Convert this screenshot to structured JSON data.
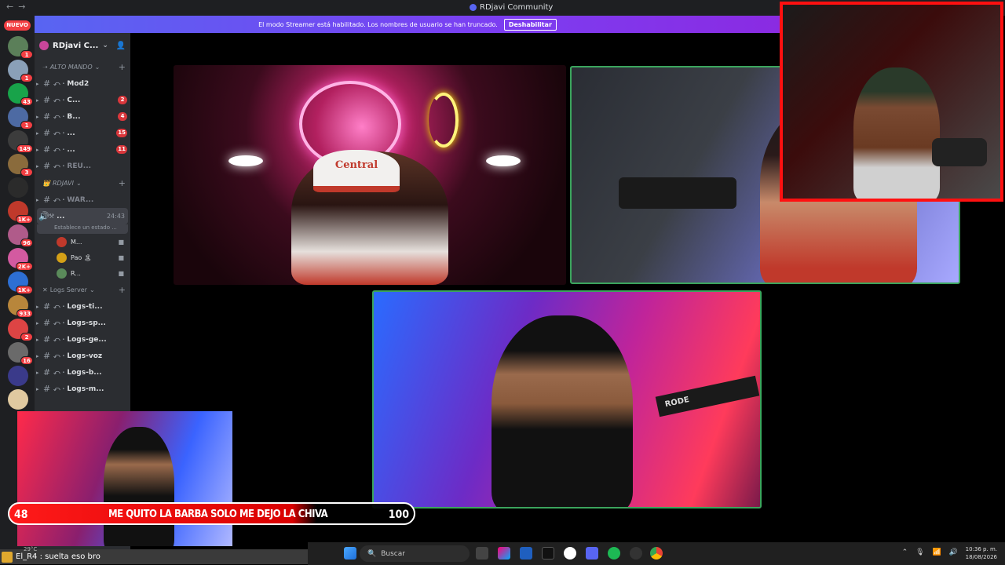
{
  "window": {
    "title": "RDjavi Community",
    "nav_back": "←",
    "nav_forward": "→"
  },
  "banner": {
    "text": "El modo Streamer está habilitado. Los nombres de usuario se han truncado.",
    "button": "Deshabilitar"
  },
  "rail": {
    "new_label": "NUEVO",
    "servers": [
      {
        "count": "1",
        "color": "#5b7f59"
      },
      {
        "count": "1",
        "color": "#8aa0b8"
      },
      {
        "count": "43",
        "color": "#18a34a"
      },
      {
        "count": "1",
        "color": "#4d6aa3"
      },
      {
        "count": "149",
        "color": "#3c3c3c"
      },
      {
        "count": "3",
        "color": "#8a6b3c"
      },
      {
        "count": "",
        "color": "#2b2b2b"
      },
      {
        "count": "1K+",
        "color": "#c0392b"
      },
      {
        "count": "96",
        "color": "#b05b8a"
      },
      {
        "count": "2K+",
        "color": "#d35aa0"
      },
      {
        "count": "1K+",
        "color": "#2d6fd3"
      },
      {
        "count": "933",
        "color": "#b8863b"
      },
      {
        "count": "2",
        "color": "#d44"
      },
      {
        "count": "16",
        "color": "#6a6a6a"
      },
      {
        "count": "",
        "color": "#3a3a8a"
      },
      {
        "count": "",
        "color": "#e0c9a0"
      }
    ]
  },
  "sidebar": {
    "server_name": "RDjavi C...",
    "chevron": "⌄",
    "categories": [
      {
        "name": "ALTO MANDO",
        "plus": "+"
      },
      {
        "name": "RDJAVI",
        "plus": "+"
      },
      {
        "name": "Logs Server",
        "plus": "+"
      }
    ],
    "alto_mando": [
      {
        "name": "Mod2",
        "count": ""
      },
      {
        "name": "C...",
        "count": "2"
      },
      {
        "name": "B...",
        "count": "4"
      },
      {
        "name": "...",
        "count": "15"
      },
      {
        "name": "...",
        "count": "11"
      },
      {
        "name": "REU...",
        "count": "",
        "muted": true
      }
    ],
    "rdjavi": [
      {
        "name": "WAR...",
        "count": "",
        "muted": true
      }
    ],
    "active_voice": {
      "name": "...",
      "time": "24:43",
      "status": "Establece un estado ..."
    },
    "voice_users": [
      {
        "name": "M...",
        "color": "#c0392b"
      },
      {
        "name": "Pao 🏝",
        "color": "#d4a017"
      },
      {
        "name": "R...",
        "color": "#5a8a5a"
      }
    ],
    "logs": [
      {
        "name": "Logs-ti..."
      },
      {
        "name": "Logs-sp..."
      },
      {
        "name": "Logs-ge..."
      },
      {
        "name": "Logs-voz"
      },
      {
        "name": "Logs-b..."
      },
      {
        "name": "Logs-m..."
      }
    ]
  },
  "tiles": {
    "tile1_cap": "Central",
    "tile3_cap": "RODE"
  },
  "goal": {
    "current": "48",
    "label": "ME QUITO LA BARBA SOLO ME DEJO LA CHIVA",
    "max": "100",
    "progress": 0.48
  },
  "ticker": {
    "text": "El_R4 : suelta eso bro"
  },
  "taskbar": {
    "search": "Buscar",
    "time": "10:36 p. m.",
    "date": "18/08/2026",
    "weather": "29°C"
  },
  "colors": {
    "accent": "#5865f2",
    "live": "#3ba55d",
    "alert": "#f23f43",
    "goal": "#ff1a1a"
  }
}
